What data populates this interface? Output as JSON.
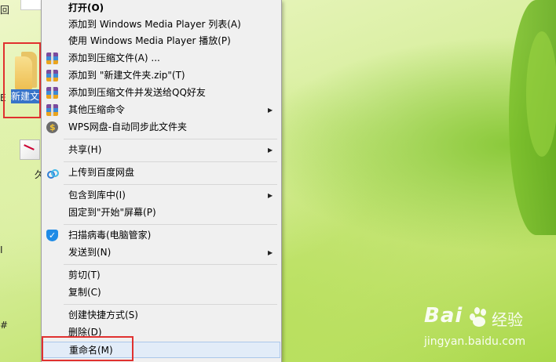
{
  "desktop": {
    "folder_label": "新建文",
    "partial_labels": [
      "回",
      "E",
      "久",
      "I",
      "#"
    ]
  },
  "menu": {
    "items": [
      {
        "label": "打开(O)",
        "bold": true
      },
      {
        "label": "添加到 Windows Media Player 列表(A)"
      },
      {
        "label": "使用 Windows Media Player 播放(P)"
      },
      {
        "label": "添加到压缩文件(A) ...",
        "icon": "winrar-icon"
      },
      {
        "label": "添加到 \"新建文件夹.zip\"(T)",
        "icon": "winrar-icon"
      },
      {
        "label": "添加到压缩文件并发送给QQ好友",
        "icon": "winrar-icon"
      },
      {
        "label": "其他压缩命令",
        "icon": "winrar-icon",
        "submenu": true
      },
      {
        "label": "WPS网盘-自动同步此文件夹",
        "icon": "wps-cloud-icon"
      },
      {
        "label": "共享(H)",
        "submenu": true
      },
      {
        "label": "上传到百度网盘",
        "icon": "baidu-netdisk-icon"
      },
      {
        "label": "包含到库中(I)",
        "submenu": true
      },
      {
        "label": "固定到\"开始\"屏幕(P)"
      },
      {
        "label": "扫描病毒(电脑管家)",
        "icon": "pc-manager-shield-icon"
      },
      {
        "label": "发送到(N)",
        "submenu": true
      },
      {
        "label": "剪切(T)"
      },
      {
        "label": "复制(C)"
      },
      {
        "label": "创建快捷方式(S)"
      },
      {
        "label": "删除(D)"
      },
      {
        "label": "重命名(M)",
        "highlighted": true
      }
    ],
    "submenu_arrow": "▶"
  },
  "watermark": {
    "brand": "Bai",
    "brand_suffix": "经验",
    "url": "jingyan.baidu.com"
  },
  "colors": {
    "menu_bg": "#f0f0f0",
    "highlight": "#e2ecf8",
    "annotation_red": "#e0312f"
  }
}
